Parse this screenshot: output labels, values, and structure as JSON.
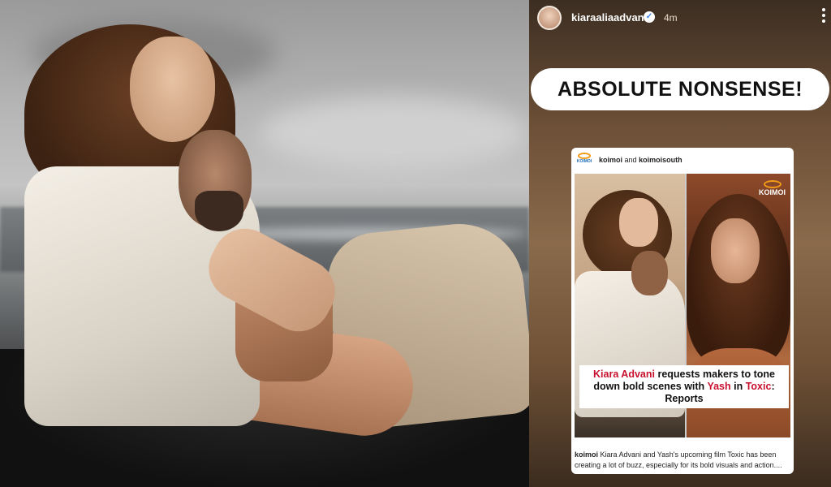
{
  "story": {
    "username": "kiaraaliaadvani",
    "verified": true,
    "time": "4m",
    "headline_sticker": "ABSOLUTE NONSENSE!"
  },
  "post": {
    "account_primary": "koimoi",
    "connector": "and",
    "account_secondary": "koimoisouth",
    "logo_text": "KOIMOI",
    "watermark": "KOIMOI",
    "headline_segments": [
      {
        "text": "Kiara Advani",
        "highlight": true
      },
      {
        "text": " requests makers to tone down bold scenes with ",
        "highlight": false
      },
      {
        "text": "Yash",
        "highlight": true
      },
      {
        "text": " in ",
        "highlight": false
      },
      {
        "text": "Toxic",
        "highlight": true
      },
      {
        "text": ": Reports",
        "highlight": false
      }
    ],
    "caption_account": "koimoi",
    "caption_text": " Kiara Advani and Yash's upcoming film Toxic has been creating a lot of buzz, especially for its bold visuals and action...."
  },
  "colors": {
    "highlight_red": "#c8102e",
    "koimoi_orange": "#f29b19",
    "verified_blue": "#3b82f6"
  },
  "icons": {
    "verified": "verified-badge-icon",
    "more": "more-vertical-icon"
  }
}
